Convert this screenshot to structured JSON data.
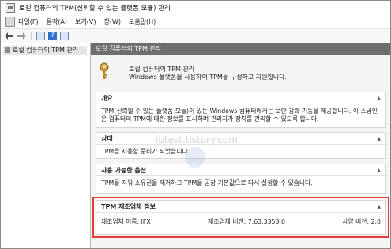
{
  "window": {
    "title": "로컬 컴퓨터의 TPM(신뢰할 수 있는 플랫폼 모듈) 관리"
  },
  "menu": {
    "items": [
      "파일(F)",
      "동작(A)",
      "보기(V)",
      "창(W)",
      "도움말(H)"
    ]
  },
  "toolbar": {
    "back_icon": "back-arrow-icon",
    "forward_icon": "forward-arrow-icon",
    "help_label": "?"
  },
  "nav": {
    "item_label": "로컬 컴퓨터의 TPM 관리"
  },
  "content": {
    "header": "로컬 컴퓨터의 TPM 관리",
    "intro_title": "로컬 컴퓨터의 TPM 관리",
    "intro_desc": "Windows 플랫폼을 사용하여 TPM을 구성하고 지원합니다.",
    "sections": {
      "overview": {
        "title": "개요",
        "text": "TPM(신뢰할 수 있는 플랫폼 모듈)이 있는 Windows 컴퓨터에서는 보안 강화 기능을 제공합니다. 이 스냅인은 컴퓨터의 TPM에 대한 정보를 표시하며 관리자가 장치를 관리할 수 있도록 합니다."
      },
      "status": {
        "title": "상태",
        "text": "TPM을 사용할 준비가 되었습니다."
      },
      "actions": {
        "title": "사용 가능한 옵션",
        "text": "TPM을 지워 소유권을 제거하고 TPM을 공장 기본값으로 다시 설정할 수 있습니다."
      },
      "manufacturer": {
        "title": "TPM 제조업체 정보",
        "name": "제조업체 이름: IFX",
        "version": "제조업체 버전: 7.63.3353.0",
        "spec": "사양 버전: 2.0"
      }
    }
  },
  "watermark": {
    "text": "ibtest.tistory.com"
  },
  "colors": {
    "highlight_border": "#e53b3b",
    "content_header_bg": "#6e6e6e"
  }
}
